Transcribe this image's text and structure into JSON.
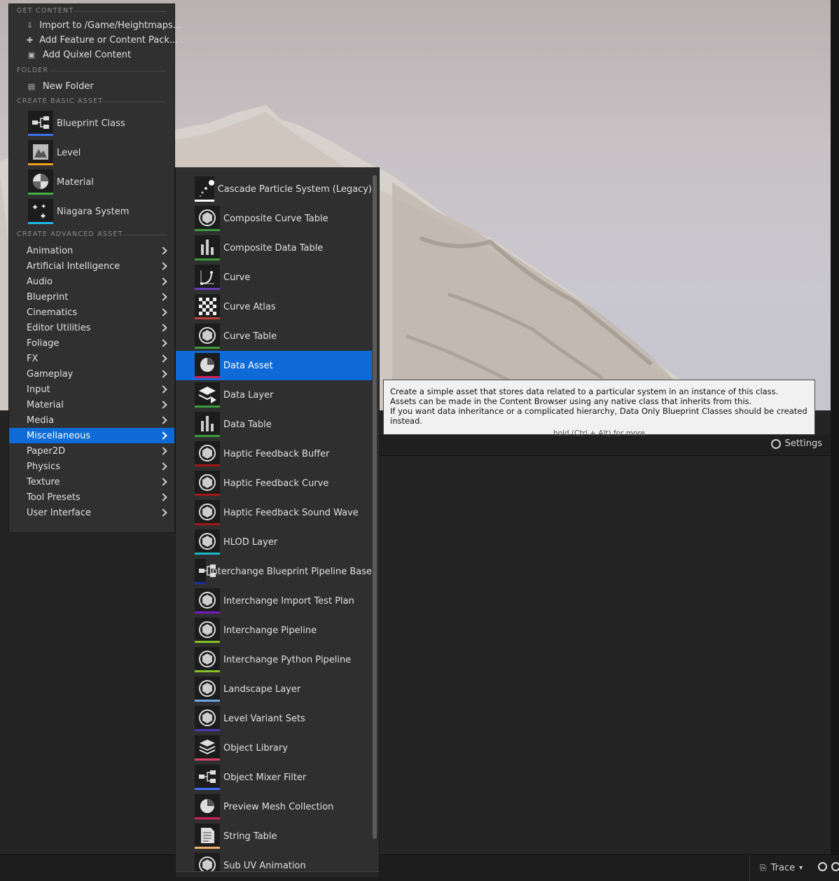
{
  "menu": {
    "sections": {
      "get_content": "GET CONTENT",
      "folder": "FOLDER",
      "basic": "CREATE BASIC ASSET",
      "advanced": "CREATE ADVANCED ASSET"
    },
    "get_content_items": [
      {
        "label": "Import to /Game/Heightmaps...",
        "icon": "import-icon"
      },
      {
        "label": "Add Feature or Content Pack...",
        "icon": "content-pack-icon"
      },
      {
        "label": "Add Quixel Content",
        "icon": "quixel-icon"
      }
    ],
    "folder_items": [
      {
        "label": "New Folder",
        "icon": "new-folder-icon"
      }
    ],
    "basic_assets": [
      {
        "label": "Blueprint Class",
        "icon": "blueprint-icon",
        "color": "#3d6ff2"
      },
      {
        "label": "Level",
        "icon": "level-icon",
        "color": "#f0a020"
      },
      {
        "label": "Material",
        "icon": "material-icon",
        "color": "#44b040"
      },
      {
        "label": "Niagara System",
        "icon": "niagara-icon",
        "color": "#20b8e8"
      }
    ],
    "advanced_categories": [
      "Animation",
      "Artificial Intelligence",
      "Audio",
      "Blueprint",
      "Cinematics",
      "Editor Utilities",
      "Foliage",
      "FX",
      "Gameplay",
      "Input",
      "Material",
      "Media",
      "Miscellaneous",
      "Paper2D",
      "Physics",
      "Texture",
      "Tool Presets",
      "User Interface"
    ],
    "active_category": "Miscellaneous"
  },
  "submenu": {
    "items": [
      {
        "label": "Cascade Particle System (Legacy)",
        "icon": "particle-icon",
        "color": "#ffffff"
      },
      {
        "label": "Composite Curve Table",
        "icon": "sphere-icon",
        "color": "#3d9a3d"
      },
      {
        "label": "Composite Data Table",
        "icon": "bars-icon",
        "color": "#3d9a3d"
      },
      {
        "label": "Curve",
        "icon": "curve-icon",
        "color": "#6a3bc2"
      },
      {
        "label": "Curve Atlas",
        "icon": "checker-icon",
        "color": "#c04040"
      },
      {
        "label": "Curve Table",
        "icon": "sphere-icon",
        "color": "#3d9a3d"
      },
      {
        "label": "Data Asset",
        "icon": "pie-icon",
        "color": "#d02060"
      },
      {
        "label": "Data Layer",
        "icon": "layers-icon",
        "color": "#3d9a3d"
      },
      {
        "label": "Data Table",
        "icon": "bars-icon",
        "color": "#3d9a3d"
      },
      {
        "label": "Haptic Feedback Buffer",
        "icon": "sphere-icon",
        "color": "#a01818"
      },
      {
        "label": "Haptic Feedback Curve",
        "icon": "sphere-icon",
        "color": "#a01818"
      },
      {
        "label": "Haptic Feedback Sound Wave",
        "icon": "sphere-icon",
        "color": "#a01818"
      },
      {
        "label": "HLOD Layer",
        "icon": "sphere-icon",
        "color": "#18b8c8"
      },
      {
        "label": "Interchange Blueprint Pipeline Base",
        "icon": "blueprint-icon",
        "color": "#1a2ea0"
      },
      {
        "label": "Interchange Import Test Plan",
        "icon": "sphere-icon",
        "color": "#7a18c8"
      },
      {
        "label": "Interchange Pipeline",
        "icon": "sphere-icon",
        "color": "#88c028"
      },
      {
        "label": "Interchange Python Pipeline",
        "icon": "sphere-icon",
        "color": "#88c028"
      },
      {
        "label": "Landscape Layer",
        "icon": "sphere-icon",
        "color": "#6aa8e8"
      },
      {
        "label": "Level Variant Sets",
        "icon": "sphere-icon",
        "color": "#4a3ab0"
      },
      {
        "label": "Object Library",
        "icon": "stack-icon",
        "color": "#e0406a"
      },
      {
        "label": "Object Mixer Filter",
        "icon": "blueprint-icon",
        "color": "#3d6ff2"
      },
      {
        "label": "Preview Mesh Collection",
        "icon": "pie-icon",
        "color": "#d02060"
      },
      {
        "label": "String Table",
        "icon": "document-icon",
        "color": "#f0b070"
      },
      {
        "label": "Sub UV Animation",
        "icon": "sphere-icon",
        "color": "#3d9a3d"
      }
    ],
    "active_item": "Data Asset"
  },
  "tooltip": {
    "lines": [
      "Create a simple asset that stores data related to a particular system in an instance of this class.",
      "Assets can be made in the Content Browser using any native class that inherits from this.",
      "If you want data inheritance or a complicated hierarchy, Data Only Blueprint Classes should be created instead."
    ],
    "hint": "hold (Ctrl + Alt) for more"
  },
  "panel": {
    "settings_label": "Settings"
  },
  "statusbar": {
    "trace_label": "Trace"
  }
}
